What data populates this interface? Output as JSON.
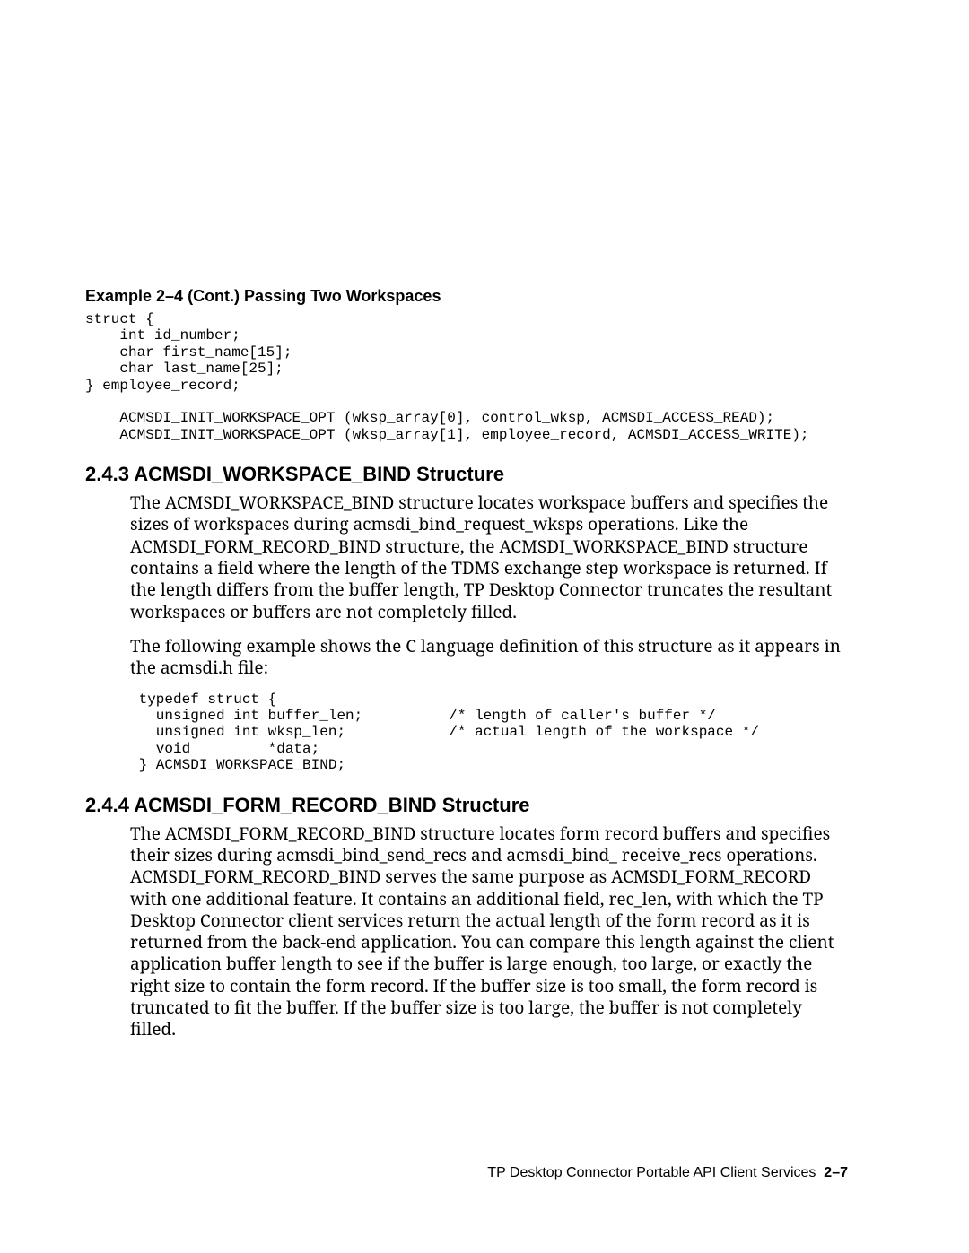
{
  "example": {
    "title": "Example 2–4 (Cont.)   Passing Two Workspaces",
    "code": "struct {\n    int id_number;\n    char first_name[15];\n    char last_name[25];\n} employee_record;\n\n    ACMSDI_INIT_WORKSPACE_OPT (wksp_array[0], control_wksp, ACMSDI_ACCESS_READ);\n    ACMSDI_INIT_WORKSPACE_OPT (wksp_array[1], employee_record, ACMSDI_ACCESS_WRITE);"
  },
  "section_243": {
    "heading": "2.4.3  ACMSDI_WORKSPACE_BIND Structure",
    "para1": "The ACMSDI_WORKSPACE_BIND structure locates workspace buffers and specifies the sizes of workspaces during acmsdi_bind_request_wksps operations. Like the ACMSDI_FORM_RECORD_BIND structure, the ACMSDI_WORKSPACE_BIND structure contains a field where the length of the TDMS exchange step workspace is returned. If the length differs from the buffer length, TP Desktop Connector truncates the resultant workspaces or buffers are not completely filled.",
    "para2": "The following example shows the C language definition of this structure as it appears in the acmsdi.h file:",
    "code": " typedef struct {\n   unsigned int buffer_len;          /* length of caller's buffer */\n   unsigned int wksp_len;            /* actual length of the workspace */\n   void         *data;\n } ACMSDI_WORKSPACE_BIND;"
  },
  "section_244": {
    "heading": "2.4.4  ACMSDI_FORM_RECORD_BIND Structure",
    "para1": "The ACMSDI_FORM_RECORD_BIND structure locates form record buffers and specifies their sizes during acmsdi_bind_send_recs and acmsdi_bind_ receive_recs operations. ACMSDI_FORM_RECORD_BIND serves the same purpose as ACMSDI_FORM_RECORD with one additional feature. It contains an additional field, rec_len, with which the TP Desktop Connector client services return the actual length of the form record as it is returned from the back-end application. You can compare this length against the client application buffer length to see if the buffer is large enough, too large, or exactly the right size to contain the form record. If the buffer size is too small, the form record is truncated to fit the buffer. If the buffer size is too large, the buffer is not completely filled."
  },
  "footer": {
    "text": "TP Desktop Connector Portable API Client Services",
    "page": "2–7"
  }
}
